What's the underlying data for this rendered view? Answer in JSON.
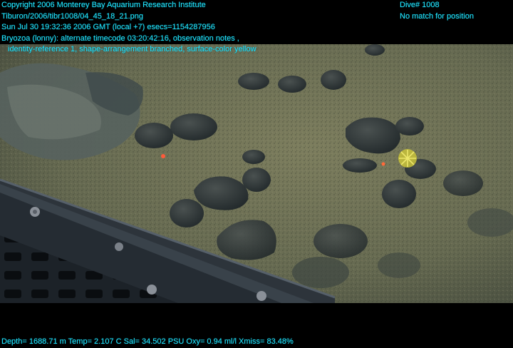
{
  "header": {
    "copyright": "Copyright 2006 Monterey Bay Aquarium Research Institute",
    "image_path": "Tiburon/2006/tibr1008/04_45_18_21.png",
    "timestamp": "Sun Jul 30 19:32:36 2006 GMT (local +7)  esecs=1154287956",
    "annotation_line1": "Bryozoa (lonny): alternate timecode 03:20:42:16, observation notes ,",
    "annotation_line2": "identity-reference 1, shape-arrangement branched, surface-color yellow"
  },
  "header_right": {
    "dive": "Dive# 1008",
    "position_status": "No match for position"
  },
  "footer": {
    "sensor_readout": "Depth= 1688.71 m  Temp= 2.107 C  Sal= 34.502 PSU  Oxy= 0.94 ml/l  Xmiss= 83.48%"
  },
  "colors": {
    "overlay_text": "#22e6ff",
    "background": "#000000",
    "sediment": "#6f7257"
  }
}
